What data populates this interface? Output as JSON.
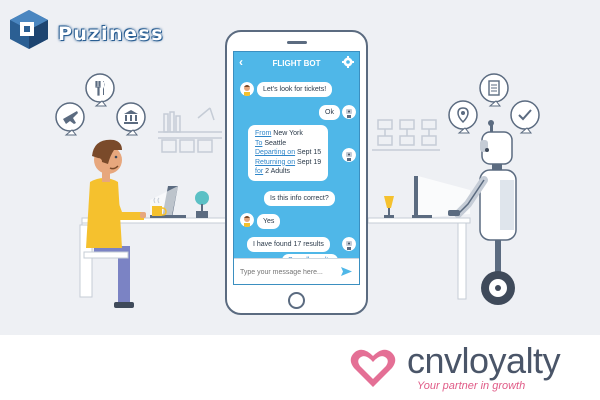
{
  "brand": {
    "puziness_name": "Puziness",
    "cnv_name": "cnvloyalty",
    "cnv_tagline": "Your partner in growth"
  },
  "chat": {
    "title": "FLIGHT BOT",
    "messages": {
      "bot_intro": "Let's look for tickets!",
      "user_ok": "Ok",
      "from_label": "From",
      "from_value": "New York",
      "to_label": "To",
      "to_value": "Seattle",
      "departing_label": "Departing on",
      "departing_value": "Sept 15",
      "returning_label": "Returning on",
      "returning_value": "Sept 19",
      "for_label": "for",
      "for_value": "2 Adults",
      "bot_confirm": "Is this info correct?",
      "user_yes": "Yes",
      "bot_results": "I have found 17 results",
      "see_all": "See all results"
    },
    "input_placeholder": "Type your message here..."
  },
  "icons": {
    "left_circles": [
      "airplane-icon",
      "restaurant-icon",
      "museum-icon"
    ],
    "right_circles": [
      "location-pin-icon",
      "checklist-icon",
      "checkmark-icon"
    ]
  },
  "colors": {
    "screen": "#4fb7e8",
    "outline": "#5b6b80",
    "brand_pink": "#e05b87",
    "person_shirt": "#f5c12e",
    "person_pants": "#7b83c4"
  }
}
